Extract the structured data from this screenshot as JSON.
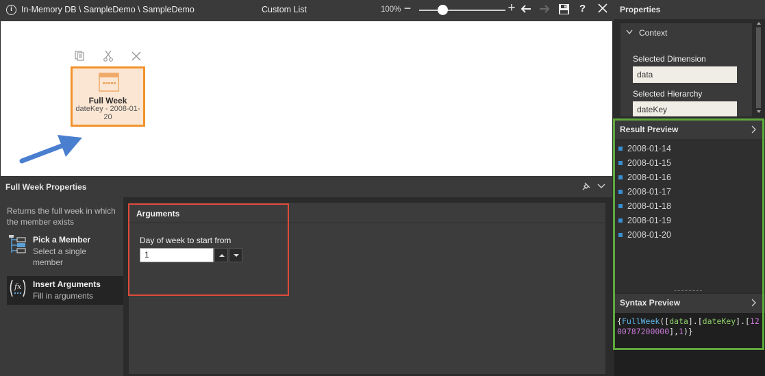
{
  "topbar": {
    "breadcrumb": "In-Memory DB \\ SampleDemo \\ SampleDemo",
    "title": "Custom List",
    "zoom": "100%",
    "zoom_level": 0.27
  },
  "canvas": {
    "node": {
      "name": "Full Week",
      "subtitle": "dateKey - 2008-01-20",
      "border_color": "#f0922a"
    }
  },
  "properties_panel": {
    "title": "Full Week Properties",
    "description": "Returns the full week in which the member exists",
    "steps": [
      {
        "title": "Pick a Member",
        "subtitle": "Select a single member",
        "icon": "pick-member-icon"
      },
      {
        "title": "Insert Arguments",
        "subtitle": "Fill in arguments",
        "icon": "fx-function-icon"
      }
    ],
    "arguments": {
      "title": "Arguments",
      "field_label": "Day of week to start from",
      "field_value": "1"
    }
  },
  "right_panel": {
    "title": "Properties",
    "context": {
      "title": "Context",
      "selected_dimension_label": "Selected Dimension",
      "selected_dimension_value": "data",
      "selected_hierarchy_label": "Selected Hierarchy",
      "selected_hierarchy_value": "dateKey"
    },
    "result_preview": {
      "title": "Result Preview",
      "items": [
        "2008-01-14",
        "2008-01-15",
        "2008-01-16",
        "2008-01-17",
        "2008-01-18",
        "2008-01-19",
        "2008-01-20"
      ]
    },
    "syntax_preview": {
      "title": "Syntax Preview",
      "code": "{FullWeek([data].[dateKey].[1200787200000],1)}"
    }
  },
  "highlight_colors": {
    "arguments_box": "#e04a3a",
    "preview_box": "#5fa83a",
    "arrow": "#4a7fd0"
  }
}
